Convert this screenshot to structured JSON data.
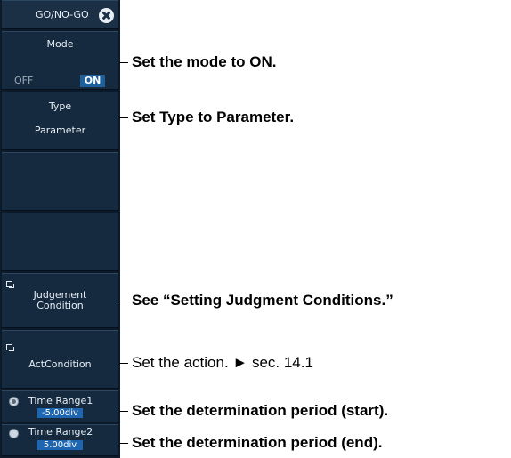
{
  "panel": {
    "title": "GO/NO-GO",
    "mode": {
      "label": "Mode",
      "off": "OFF",
      "on": "ON"
    },
    "type": {
      "label": "Type",
      "value": "Parameter"
    },
    "judgement": {
      "line1": "Judgement",
      "line2": "Condition"
    },
    "act_condition": {
      "label": "ActCondition"
    },
    "time_range1": {
      "label": "Time Range1",
      "value": "-5.00div"
    },
    "time_range2": {
      "label": "Time Range2",
      "value": "5.00div"
    }
  },
  "callouts": {
    "mode": "Set the mode to ON.",
    "type": "Set Type to Parameter.",
    "judgement": "See “Setting Judgment Conditions.”",
    "action": "Set the action. ► sec. 14.1",
    "start": "Set the determination period (start).",
    "end": "Set the determination period (end)."
  },
  "colors": {
    "panel_bg": "#0d1a29",
    "section_bg": "#162a3f",
    "selected": "#1f5f9a",
    "value_box": "#1e66b0"
  }
}
